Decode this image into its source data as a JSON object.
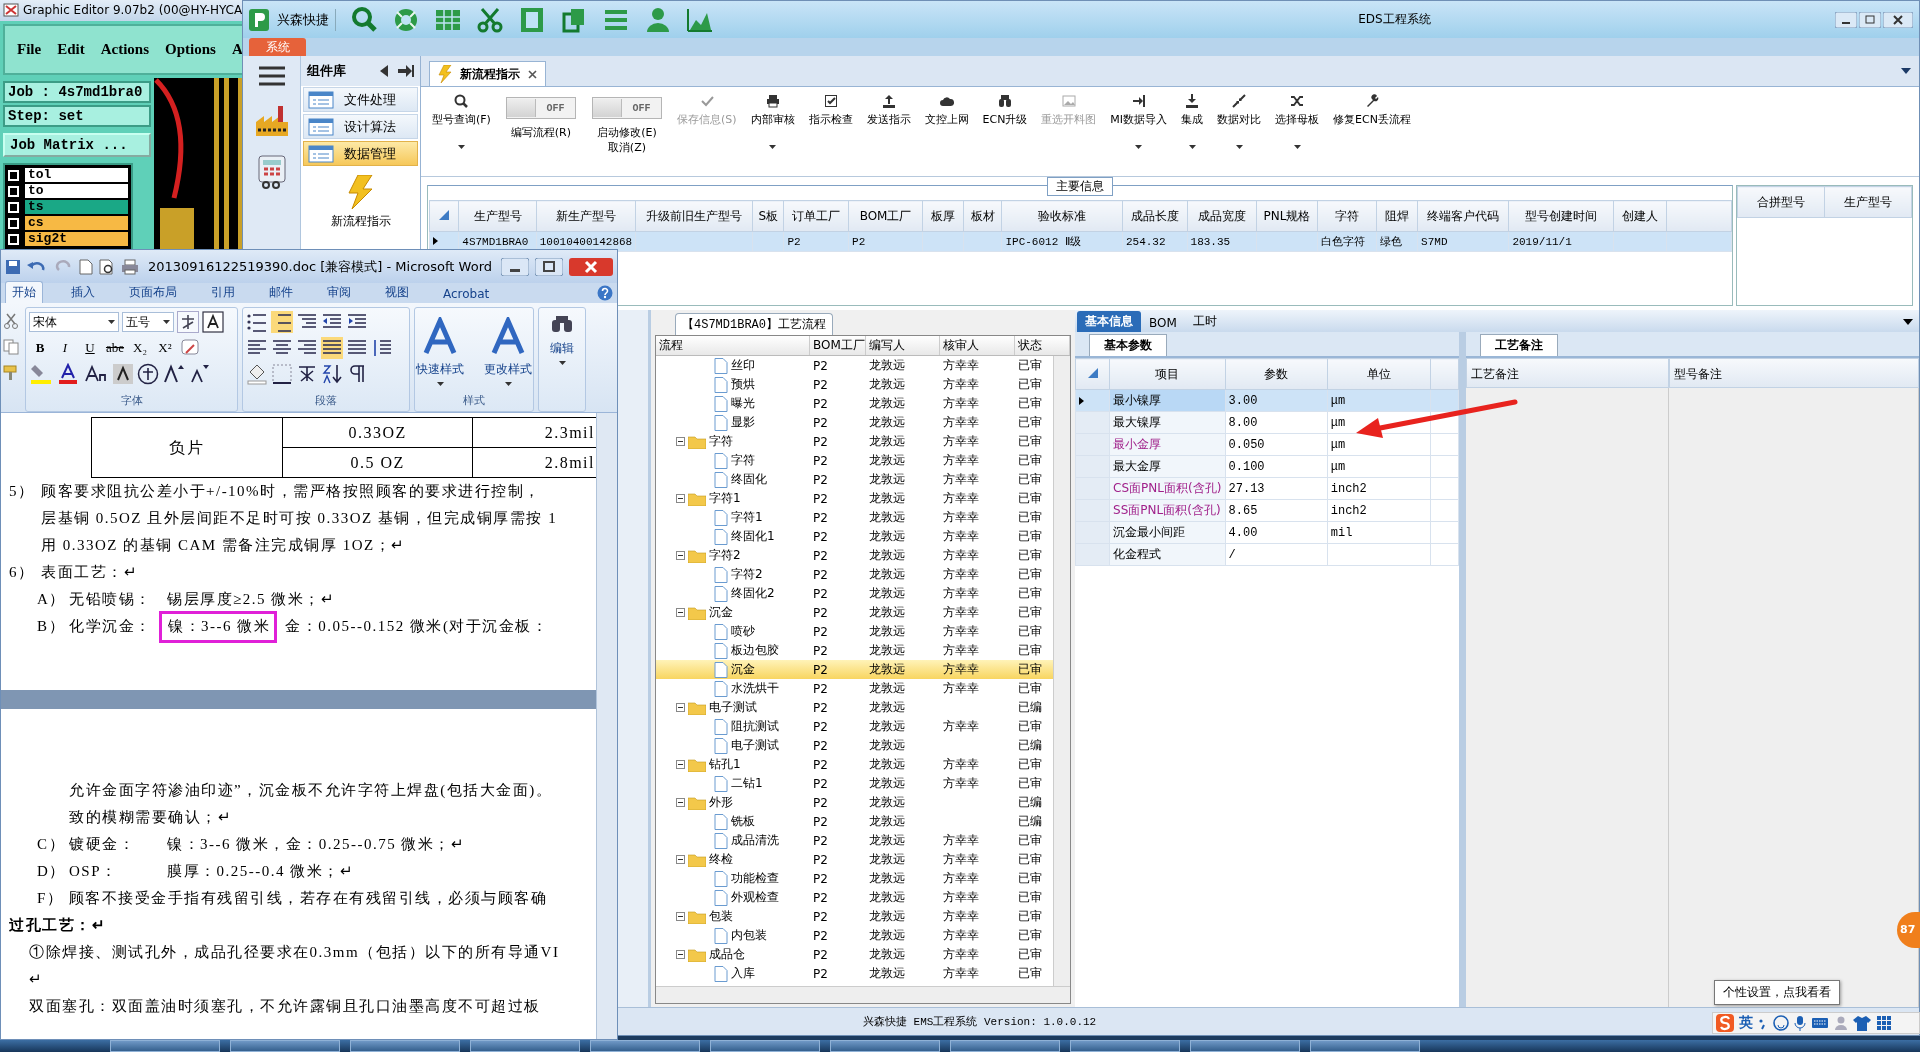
{
  "graphic_editor": {
    "title": "Graphic Editor 9.07b2 (00@HY-HYCA",
    "menu": [
      "File",
      "Edit",
      "Actions",
      "Options",
      "A"
    ],
    "job": "Job : 4s7md1bra0",
    "step": "Step: set",
    "matrix_button": "Job Matrix ...",
    "layers": [
      {
        "name": "tol",
        "color": "#ffffff",
        "checked": false
      },
      {
        "name": "to",
        "color": "#ffffff",
        "checked": false
      },
      {
        "name": "ts",
        "color": "#1aa886",
        "checked": false
      },
      {
        "name": "cs",
        "color": "#f7b944",
        "checked": false
      },
      {
        "name": "sig2t",
        "color": "#f7b944",
        "checked": false
      }
    ]
  },
  "eds": {
    "brand": "兴森快捷",
    "title": "EDS工程系统",
    "menu_tab": "系统",
    "nav": {
      "title": "组件库",
      "items": [
        {
          "label": "文件处理",
          "selected": false
        },
        {
          "label": "设计算法",
          "selected": false
        },
        {
          "label": "数据管理",
          "selected": true
        }
      ],
      "launcher": "新流程指示"
    },
    "doc_tab": {
      "label": "新流程指示",
      "selected": true
    },
    "ribbon": [
      {
        "kind": "button",
        "label": "型号查询(F)",
        "dropdown": true,
        "disabled": false
      },
      {
        "kind": "toggle",
        "label": "编写流程(R)",
        "switch_text": "OFF",
        "on": false
      },
      {
        "kind": "toggle",
        "label": "启动修改(E)",
        "sublabel": "取消(Z)",
        "switch_text": "OFF",
        "on": false
      },
      {
        "kind": "button",
        "label": "保存信息(S)",
        "dropdown": false,
        "disabled": true
      },
      {
        "kind": "button",
        "label": "内部审核",
        "dropdown": true,
        "disabled": false
      },
      {
        "kind": "button",
        "label": "指示检查",
        "dropdown": false,
        "disabled": false
      },
      {
        "kind": "button",
        "label": "发送指示",
        "dropdown": false,
        "disabled": false
      },
      {
        "kind": "button",
        "label": "文控上网",
        "dropdown": false,
        "disabled": false
      },
      {
        "kind": "button",
        "label": "ECN升级",
        "dropdown": false,
        "disabled": false
      },
      {
        "kind": "button",
        "label": "重选开料图",
        "dropdown": false,
        "disabled": true
      },
      {
        "kind": "button",
        "label": "MI数据导入",
        "dropdown": true,
        "disabled": false
      },
      {
        "kind": "button",
        "label": "集成",
        "dropdown": true,
        "disabled": false
      },
      {
        "kind": "button",
        "label": "数据对比",
        "dropdown": true,
        "disabled": false
      },
      {
        "kind": "button",
        "label": "选择母板",
        "dropdown": true,
        "disabled": false
      },
      {
        "kind": "button",
        "label": "修复ECN丢流程",
        "dropdown": false,
        "disabled": false
      }
    ],
    "main_info": {
      "title": "主要信息",
      "row_selected": true,
      "columns": [
        {
          "label": "生产型号",
          "value": "4S7MD1BRA0"
        },
        {
          "label": "新生产型号",
          "value": "10010400142868"
        },
        {
          "label": "升级前旧生产型号"
        },
        {
          "label": "S板"
        },
        {
          "label": "订单工厂",
          "value": "P2"
        },
        {
          "label": "BOM工厂",
          "value": "P2"
        },
        {
          "label": "板厚"
        },
        {
          "label": "板材"
        },
        {
          "label": "验收标准",
          "value": "IPC-6012 Ⅱ级"
        },
        {
          "label": "成品长度",
          "value": "254.32"
        },
        {
          "label": "成品宽度",
          "value": "183.35"
        },
        {
          "label": "PNL规格"
        },
        {
          "label": "字符",
          "value": "白色字符"
        },
        {
          "label": "阻焊",
          "value": "绿色"
        },
        {
          "label": "终端客户代码",
          "value": "S7MD"
        },
        {
          "label": "型号创建时间",
          "value": "2019/11/1"
        },
        {
          "label": "创建人"
        }
      ]
    },
    "merge_grid": {
      "columns": [
        "合拼型号",
        "生产型号"
      ]
    },
    "process": {
      "title": "【4S7MD1BRA0】工艺流程",
      "columns": [
        "流程",
        "BOM工厂",
        "编写人",
        "核审人",
        "状态"
      ],
      "tree": [
        {
          "kind": "continued",
          "children": [
            {
              "label": "丝印",
              "bom": "P2",
              "writer": "龙敦远",
              "reviewer": "方幸幸",
              "status": "已审",
              "selected": false
            },
            {
              "label": "预烘",
              "bom": "P2",
              "writer": "龙敦远",
              "reviewer": "方幸幸",
              "status": "已审",
              "selected": false
            },
            {
              "label": "曝光",
              "bom": "P2",
              "writer": "龙敦远",
              "reviewer": "方幸幸",
              "status": "已审",
              "selected": false
            },
            {
              "label": "显影",
              "bom": "P2",
              "writer": "龙敦远",
              "reviewer": "方幸幸",
              "status": "已审",
              "selected": false
            }
          ]
        },
        {
          "kind": "group",
          "label": "字符",
          "bom": "P2",
          "writer": "龙敦远",
          "reviewer": "方幸幸",
          "status": "已审",
          "selected": false,
          "expanded": true,
          "children": [
            {
              "label": "字符",
              "bom": "P2",
              "writer": "龙敦远",
              "reviewer": "方幸幸",
              "status": "已审",
              "selected": false
            },
            {
              "label": "终固化",
              "bom": "P2",
              "writer": "龙敦远",
              "reviewer": "方幸幸",
              "status": "已审",
              "selected": false
            }
          ]
        },
        {
          "kind": "group",
          "label": "字符1",
          "bom": "P2",
          "writer": "龙敦远",
          "reviewer": "方幸幸",
          "status": "已审",
          "selected": false,
          "expanded": true,
          "children": [
            {
              "label": "字符1",
              "bom": "P2",
              "writer": "龙敦远",
              "reviewer": "方幸幸",
              "status": "已审",
              "selected": false
            },
            {
              "label": "终固化1",
              "bom": "P2",
              "writer": "龙敦远",
              "reviewer": "方幸幸",
              "status": "已审",
              "selected": false
            }
          ]
        },
        {
          "kind": "group",
          "label": "字符2",
          "bom": "P2",
          "writer": "龙敦远",
          "reviewer": "方幸幸",
          "status": "已审",
          "selected": false,
          "expanded": true,
          "children": [
            {
              "label": "字符2",
              "bom": "P2",
              "writer": "龙敦远",
              "reviewer": "方幸幸",
              "status": "已审",
              "selected": false
            },
            {
              "label": "终固化2",
              "bom": "P2",
              "writer": "龙敦远",
              "reviewer": "方幸幸",
              "status": "已审",
              "selected": false
            }
          ]
        },
        {
          "kind": "group",
          "label": "沉金",
          "bom": "P2",
          "writer": "龙敦远",
          "reviewer": "方幸幸",
          "status": "已审",
          "selected": false,
          "expanded": true,
          "children": [
            {
              "label": "喷砂",
              "bom": "P2",
              "writer": "龙敦远",
              "reviewer": "方幸幸",
              "status": "已审",
              "selected": false
            },
            {
              "label": "板边包胶",
              "bom": "P2",
              "writer": "龙敦远",
              "reviewer": "方幸幸",
              "status": "已审",
              "selected": false
            },
            {
              "label": "沉金",
              "bom": "P2",
              "writer": "龙敦远",
              "reviewer": "方幸幸",
              "status": "已审",
              "selected": true
            },
            {
              "label": "水洗烘干",
              "bom": "P2",
              "writer": "龙敦远",
              "reviewer": "方幸幸",
              "status": "已审",
              "selected": false
            }
          ]
        },
        {
          "kind": "group",
          "label": "电子测试",
          "bom": "P2",
          "writer": "龙敦远",
          "status": "已编",
          "selected": false,
          "expanded": true,
          "children": [
            {
              "label": "阻抗测试",
              "bom": "P2",
              "writer": "龙敦远",
              "reviewer": "方幸幸",
              "status": "已审",
              "selected": false
            },
            {
              "label": "电子测试",
              "bom": "P2",
              "writer": "龙敦远",
              "status": "已编",
              "selected": false
            }
          ]
        },
        {
          "kind": "group",
          "label": "钻孔1",
          "bom": "P2",
          "writer": "龙敦远",
          "reviewer": "方幸幸",
          "status": "已审",
          "selected": false,
          "expanded": true,
          "children": [
            {
              "label": "二钻1",
              "bom": "P2",
              "writer": "龙敦远",
              "reviewer": "方幸幸",
              "status": "已审",
              "selected": false
            }
          ]
        },
        {
          "kind": "group",
          "label": "外形",
          "bom": "P2",
          "writer": "龙敦远",
          "status": "已编",
          "selected": false,
          "expanded": true,
          "children": [
            {
              "label": "铣板",
              "bom": "P2",
              "writer": "龙敦远",
              "status": "已编",
              "selected": false
            },
            {
              "label": "成品清洗",
              "bom": "P2",
              "writer": "龙敦远",
              "reviewer": "方幸幸",
              "status": "已审",
              "selected": false
            }
          ]
        },
        {
          "kind": "group",
          "label": "终检",
          "bom": "P2",
          "writer": "龙敦远",
          "reviewer": "方幸幸",
          "status": "已审",
          "selected": false,
          "expanded": true,
          "children": [
            {
              "label": "功能检查",
              "bom": "P2",
              "writer": "龙敦远",
              "reviewer": "方幸幸",
              "status": "已审",
              "selected": false
            },
            {
              "label": "外观检查",
              "bom": "P2",
              "writer": "龙敦远",
              "reviewer": "方幸幸",
              "status": "已审",
              "selected": false
            }
          ]
        },
        {
          "kind": "group",
          "label": "包装",
          "bom": "P2",
          "writer": "龙敦远",
          "reviewer": "方幸幸",
          "status": "已审",
          "selected": false,
          "expanded": true,
          "children": [
            {
              "label": "内包装",
              "bom": "P2",
              "writer": "龙敦远",
              "reviewer": "方幸幸",
              "status": "已审",
              "selected": false
            }
          ]
        },
        {
          "kind": "group",
          "label": "成品仓",
          "bom": "P2",
          "writer": "龙敦远",
          "reviewer": "方幸幸",
          "status": "已审",
          "selected": false,
          "expanded": true,
          "children": [
            {
              "label": "入库",
              "bom": "P2",
              "writer": "龙敦远",
              "reviewer": "方幸幸",
              "status": "已审",
              "selected": false
            }
          ]
        }
      ]
    },
    "info_tabs": [
      {
        "label": "基本信息",
        "selected": true
      },
      {
        "label": "BOM",
        "selected": false
      },
      {
        "label": "工时",
        "selected": false
      }
    ],
    "params": {
      "tab": "基本参数",
      "columns": [
        "项目",
        "参数",
        "单位"
      ],
      "rows": [
        {
          "item": "最小镍厚",
          "value": "3.00",
          "unit": "μm",
          "flagged": false,
          "selected": true
        },
        {
          "item": "最大镍厚",
          "value": "8.00",
          "unit": "μm",
          "flagged": false,
          "selected": false
        },
        {
          "item": "最小金厚",
          "value": "0.050",
          "unit": "μm",
          "flagged": true,
          "selected": false
        },
        {
          "item": "最大金厚",
          "value": "0.100",
          "unit": "μm",
          "flagged": false,
          "selected": false
        },
        {
          "item": "CS面PNL面积(含孔)",
          "value": "27.13",
          "unit": "inch2",
          "flagged": true,
          "selected": false
        },
        {
          "item": "SS面PNL面积(含孔)",
          "value": "8.65",
          "unit": "inch2",
          "flagged": true,
          "selected": false
        },
        {
          "item": "沉金最小间距",
          "value": "4.00",
          "unit": "mil",
          "flagged": false,
          "selected": false
        },
        {
          "item": "化金程式",
          "value": "/",
          "flagged": false,
          "selected": false
        }
      ]
    },
    "remarks": {
      "tab": "工艺备注",
      "columns": [
        "工艺备注",
        "型号备注"
      ]
    },
    "status": "兴森快捷 EMS工程系统 Version: 1.0.0.12"
  },
  "word": {
    "title": "20130916122519390.doc [兼容模式] - Microsoft Word",
    "tabs": [
      {
        "label": "开始",
        "selected": true
      },
      {
        "label": "插入",
        "selected": false
      },
      {
        "label": "页面布局",
        "selected": false
      },
      {
        "label": "引用",
        "selected": false
      },
      {
        "label": "邮件",
        "selected": false
      },
      {
        "label": "审阅",
        "selected": false
      },
      {
        "label": "视图",
        "selected": false
      },
      {
        "label": "Acrobat",
        "selected": false
      }
    ],
    "font_name": "宋体",
    "font_size": "五号",
    "format_buttons": [
      "B",
      "I",
      "U",
      "abe",
      "X₂",
      "X²"
    ],
    "groups": [
      "字体",
      "段落",
      "样式"
    ],
    "style_buttons": [
      "快速样式",
      "更改样式"
    ],
    "edit_button": "编辑",
    "doc": [
      {
        "kind": "table",
        "label": "负片",
        "rows": [
          [
            "0.33OZ",
            "2.3mil"
          ],
          [
            "0.5 OZ",
            "2.8mil"
          ]
        ]
      },
      {
        "kind": "numbered",
        "number": "5）",
        "lines": [
          "顾客要求阻抗公差小于+/-10%时，需严格按照顾客的要求进行控制，",
          "层基铜 0.5OZ 且外层间距不足时可按 0.33OZ 基铜，但完成铜厚需按 1",
          "用 0.33OZ 的基铜 CAM 需备注完成铜厚 1OZ；↵"
        ]
      },
      {
        "kind": "numbered",
        "number": "6）",
        "lines": [
          "表面工艺：↵"
        ]
      },
      {
        "kind": "lettered",
        "number": "A）",
        "label": "无铅喷锡：",
        "text": "锡层厚度≥2.5 微米；↵"
      },
      {
        "kind": "framed",
        "number": "B）",
        "label": "化学沉金：",
        "framed": "镍：3--6 微米",
        "text": "金：0.05--0.152 微米(对于沉金板："
      },
      {
        "kind": "page_break"
      },
      {
        "kind": "continuation",
        "lines": [
          "允许金面字符渗油印迹”，沉金板不允许字符上焊盘(包括大金面)。",
          "致的模糊需要确认；↵"
        ]
      },
      {
        "kind": "lettered",
        "number": "C）",
        "label": "镀硬金：",
        "text": "镍：3--6 微米，金：0.25--0.75 微米；↵"
      },
      {
        "kind": "lettered",
        "number": "D）",
        "label": "OSP：",
        "text": "膜厚：0.25--0.4 微米；↵"
      },
      {
        "kind": "note",
        "text": "F） 顾客不接受金手指有残留引线，若存在有残留引线，必须与顾客确"
      },
      {
        "kind": "heading",
        "text": "过孔工艺：↵"
      },
      {
        "kind": "paragraph",
        "text": "①除焊接、测试孔外，成品孔径要求在0.3mm（包括）以下的所有导通VI"
      },
      {
        "kind": "paragraph",
        "text": "↵"
      },
      {
        "kind": "paragraph",
        "text": "双面塞孔：双面盖油时须塞孔，不允许露铜且孔口油墨高度不可超过板"
      }
    ]
  },
  "desktop": {
    "tooltip": "个性设置，点我看看",
    "ime_mode": "英",
    "badge": "87"
  }
}
